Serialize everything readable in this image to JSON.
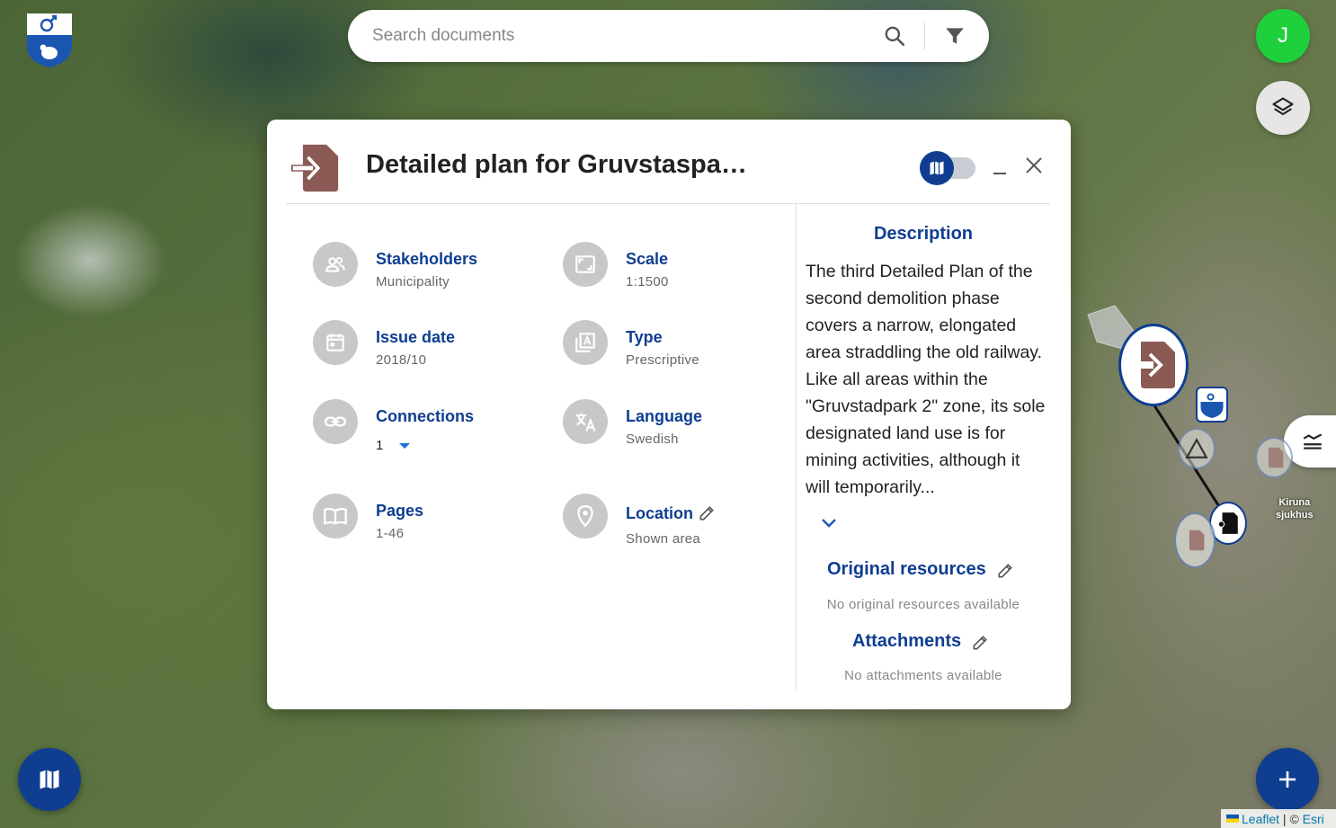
{
  "search": {
    "placeholder": "Search documents"
  },
  "user": {
    "initial": "J",
    "color": "#1ed13c"
  },
  "colors": {
    "accent": "#0f3e91",
    "doc_icon": "#8b5a55",
    "icon_bg": "#c8c8c8"
  },
  "modal": {
    "title": "Detailed plan for Gruvstaspa…",
    "fields": {
      "stakeholders": {
        "label": "Stakeholders",
        "value": "Municipality",
        "icon": "people-icon"
      },
      "scale": {
        "label": "Scale",
        "value": "1:1500",
        "icon": "aspect-ratio-icon"
      },
      "issue_date": {
        "label": "Issue date",
        "value": "2018/10",
        "icon": "calendar-icon"
      },
      "type": {
        "label": "Type",
        "value": "Prescriptive",
        "icon": "type-icon"
      },
      "connections": {
        "label": "Connections",
        "value": "1",
        "icon": "link-icon"
      },
      "language": {
        "label": "Language",
        "value": "Swedish",
        "icon": "translate-icon"
      },
      "pages": {
        "label": "Pages",
        "value": "1-46",
        "icon": "book-icon"
      },
      "location": {
        "label": "Location",
        "value": "Shown area",
        "icon": "pin-icon"
      }
    },
    "description": {
      "title": "Description",
      "text": "The third Detailed Plan of the second demolition phase covers a narrow, elongated area straddling the old railway. Like all areas within the \"Gruvstadpark 2\" zone, its sole designated land use is for mining activities, although it will temporarily..."
    },
    "original_resources": {
      "title": "Original resources",
      "empty": "No original resources available"
    },
    "attachments": {
      "title": "Attachments",
      "empty": "No attachments available"
    }
  },
  "map": {
    "place_label_line1": "Kiruna",
    "place_label_line2": "sjukhus"
  },
  "attribution": {
    "leaflet": "Leaflet",
    "separator": " | © ",
    "esri": "Esri"
  }
}
